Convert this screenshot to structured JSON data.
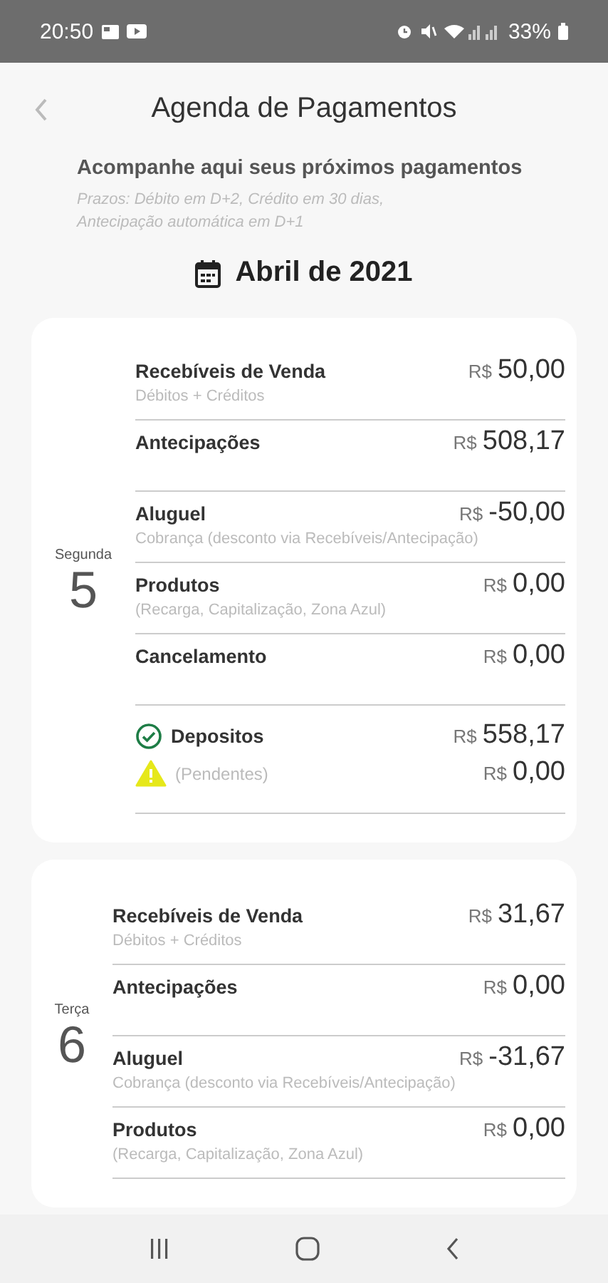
{
  "status_bar": {
    "time": "20:50",
    "battery": "33%"
  },
  "header": {
    "title": "Agenda de Pagamentos",
    "subtitle": "Acompanhe aqui seus próximos pagamentos",
    "note": "Prazos: Débito em D+2, Crédito em 30 dias, Antecipação automática em D+1"
  },
  "month": "Abril de 2021",
  "days": [
    {
      "weekday": "Segunda",
      "day": "5",
      "entries": [
        {
          "kind": "entry",
          "label": "Recebíveis de Venda",
          "currency": "R$",
          "amount": "50,00",
          "detail": "Débitos + Créditos"
        },
        {
          "kind": "entry",
          "label": "Antecipações",
          "currency": "R$",
          "amount": "508,17"
        },
        {
          "kind": "entry",
          "label": "Aluguel",
          "currency": "R$",
          "amount": "-50,00",
          "detail": "Cobrança (desconto via Recebíveis/Antecipação)"
        },
        {
          "kind": "entry",
          "label": "Produtos",
          "currency": "R$",
          "amount": "0,00",
          "detail": "(Recarga, Capitalização, Zona Azul)"
        },
        {
          "kind": "entry",
          "label": "Cancelamento",
          "currency": "R$",
          "amount": "0,00"
        },
        {
          "kind": "deposit",
          "label": "Depositos",
          "currency": "R$",
          "amount": "558,17"
        },
        {
          "kind": "pending",
          "label": "(Pendentes)",
          "currency": "R$",
          "amount": "0,00"
        }
      ]
    },
    {
      "weekday": "Terça",
      "day": "6",
      "entries": [
        {
          "kind": "entry",
          "label": "Recebíveis de Venda",
          "currency": "R$",
          "amount": "31,67",
          "detail": "Débitos + Créditos"
        },
        {
          "kind": "entry",
          "label": "Antecipações",
          "currency": "R$",
          "amount": "0,00"
        },
        {
          "kind": "entry",
          "label": "Aluguel",
          "currency": "R$",
          "amount": "-31,67",
          "detail": "Cobrança (desconto via Recebíveis/Antecipação)"
        },
        {
          "kind": "entry",
          "label": "Produtos",
          "currency": "R$",
          "amount": "0,00",
          "detail": "(Recarga, Capitalização, Zona Azul)"
        }
      ]
    }
  ]
}
